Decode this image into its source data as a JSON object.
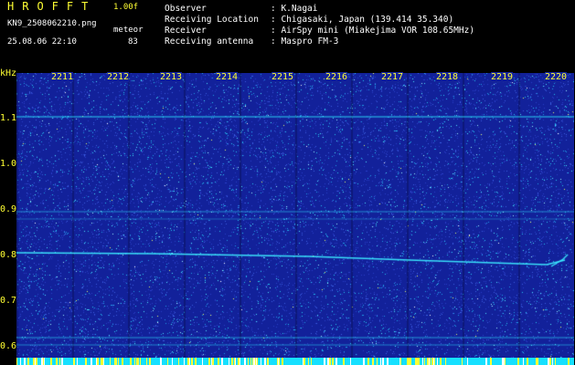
{
  "header": {
    "logo": "HROFFT",
    "version": "1.00f",
    "filename": "KN9_2508062210.png",
    "meteor_label": "meteor",
    "datetime": "25.08.06 22:10",
    "meteor_count": "83"
  },
  "info": [
    {
      "label": "Observer",
      "value": ": K.Nagai"
    },
    {
      "label": "Receiving Location",
      "value": ": Chigasaki, Japan (139.414 35.340)"
    },
    {
      "label": "Receiver",
      "value": ": AirSpy mini (Miakejima VOR 108.65MHz)"
    },
    {
      "label": "Receiving antenna",
      "value": ": Maspro FM-3"
    }
  ],
  "spectrogram": {
    "y_unit": "kHz",
    "time_labels": [
      "2211",
      "2212",
      "2213",
      "2214",
      "2215",
      "2216",
      "2217",
      "2218",
      "2219",
      "2220"
    ],
    "freq_labels": [
      "1.1",
      "1.0",
      "0.9",
      "0.8",
      "0.7",
      "0.6"
    ],
    "colors": {
      "background": "#12219a",
      "signal": "#2ee6ff",
      "text": "#ffff33",
      "strip": "#16e0ff",
      "strip_mark": "#ffff33"
    }
  }
}
